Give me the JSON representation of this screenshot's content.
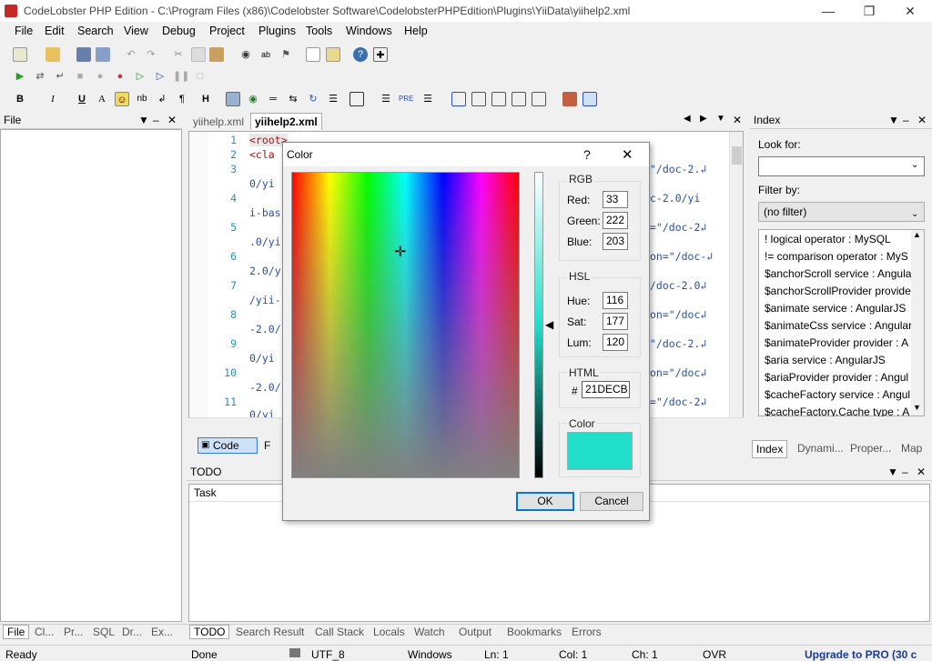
{
  "window": {
    "title": "CodeLobster PHP Edition - C:\\Program Files (x86)\\Codelobster Software\\CodelobsterPHPEdition\\Plugins\\YiiData\\yiihelp2.xml"
  },
  "menu": [
    "File",
    "Edit",
    "Search",
    "View",
    "Debug",
    "Project",
    "Plugins",
    "Tools",
    "Windows",
    "Help"
  ],
  "file_panel": {
    "title": "File"
  },
  "editor": {
    "tabs": [
      "yiihelp.xml",
      "yiihelp2.xml"
    ],
    "line_numbers": [
      "1",
      "2",
      "3",
      "4",
      "5",
      "6",
      "7",
      "8",
      "9",
      "10",
      "11"
    ],
    "lines": [
      "<root>",
      "<cla",
      "0/yi",
      "i-bas",
      ".0/yi",
      "2.0/y",
      "/yii-",
      "-2.0/",
      "0/yi",
      "-2.0/",
      "0/yi"
    ],
    "right_lines": [
      "\"/doc-2.↲",
      "c-2.0/yi",
      "=\"/doc-2↲",
      "on=\"/doc-↲",
      "/doc-2.0↲",
      "on=\"/doc↲",
      "\"/doc-2.↲",
      "on=\"/doc↲",
      "=\"/doc-2↲"
    ],
    "bottom_tabs": [
      "Code",
      "F"
    ]
  },
  "todo_panel": {
    "title": "TODO",
    "column": "Task"
  },
  "index_panel": {
    "title": "Index",
    "look_for_label": "Look for:",
    "filter_label": "Filter by:",
    "filter_value": "(no filter)",
    "items": [
      "! logical operator : MySQL",
      "!= comparison operator : MyS",
      "$anchorScroll service : Angular",
      "$anchorScrollProvider provide",
      "$animate service : AngularJS",
      "$animateCss service : Angular",
      "$animateProvider provider : A",
      "$aria service : AngularJS",
      "$ariaProvider provider : Angul",
      "$cacheFactory service : Angul",
      "$cacheFactory.Cache type : A"
    ],
    "tabs": [
      "Index",
      "Dynami...",
      "Proper...",
      "Map"
    ]
  },
  "left_bottom_tabs": [
    "File",
    "Cl...",
    "Pr...",
    "SQL",
    "Dr...",
    "Ex..."
  ],
  "bottom_tabs": [
    "TODO",
    "Search Result",
    "Call Stack",
    "Locals",
    "Watch",
    "Output",
    "Bookmarks",
    "Errors"
  ],
  "status": {
    "ready": "Ready",
    "done": "Done",
    "encoding": "UTF_8",
    "os": "Windows",
    "ln": "Ln: 1",
    "col": "Col: 1",
    "ch": "Ch: 1",
    "mode": "OVR",
    "upgrade": "Upgrade to PRO (30 c"
  },
  "dialog": {
    "title": "Color",
    "help": "?",
    "close": "✕",
    "rgb_label": "RGB",
    "red_label": "Red:",
    "red": "33",
    "green_label": "Green:",
    "green": "222",
    "blue_label": "Blue:",
    "blue": "203",
    "hsl_label": "HSL",
    "hue_label": "Hue:",
    "hue": "116",
    "sat_label": "Sat:",
    "sat": "177",
    "lum_label": "Lum:",
    "lum": "120",
    "html_label": "HTML",
    "hash": "#",
    "html": "21DECB",
    "color_label": "Color",
    "swatch_color": "#21decb",
    "ok": "OK",
    "cancel": "Cancel"
  }
}
